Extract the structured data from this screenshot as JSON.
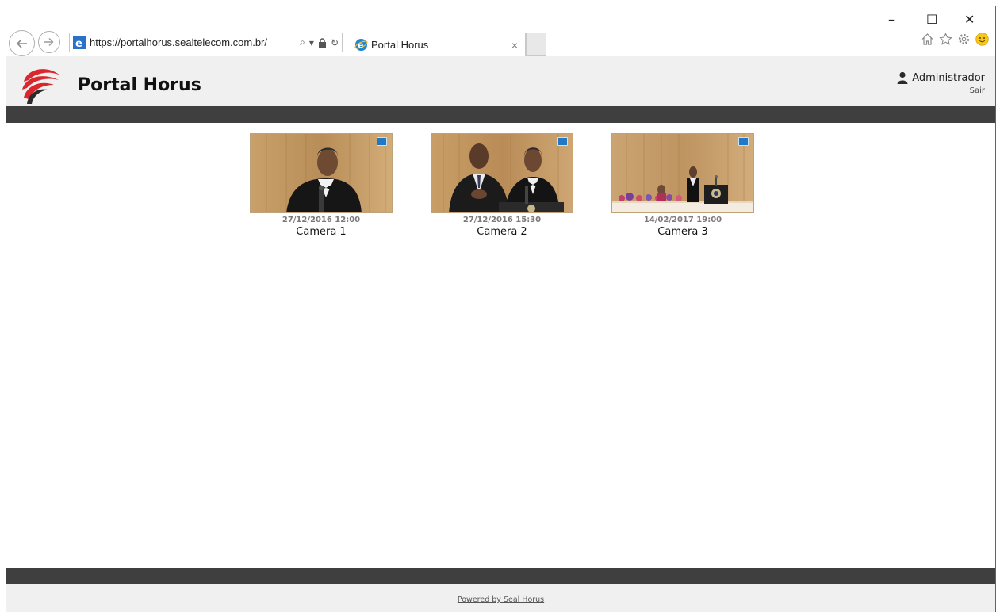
{
  "browser": {
    "url": "https://portalhorus.sealtelecom.com.br/",
    "tab_title": "Portal Horus",
    "tab_close": "×",
    "window_minimize": "–",
    "window_maximize": "☐",
    "window_close": "✕"
  },
  "header": {
    "brand": "Portal Horus",
    "user_name": "Administrador",
    "logout_label": "Sair"
  },
  "cameras": [
    {
      "timestamp": "27/12/2016 12:00",
      "name": "Camera 1"
    },
    {
      "timestamp": "27/12/2016 15:30",
      "name": "Camera 2"
    },
    {
      "timestamp": "14/02/2017 19:00",
      "name": "Camera 3"
    }
  ],
  "footer": {
    "powered_by": "Powered by Seal Horus"
  },
  "colors": {
    "header_bg": "#f0f0f0",
    "bar_dark": "#3f3f3f",
    "logo_red": "#d9272e",
    "window_border": "#1e74c3"
  }
}
